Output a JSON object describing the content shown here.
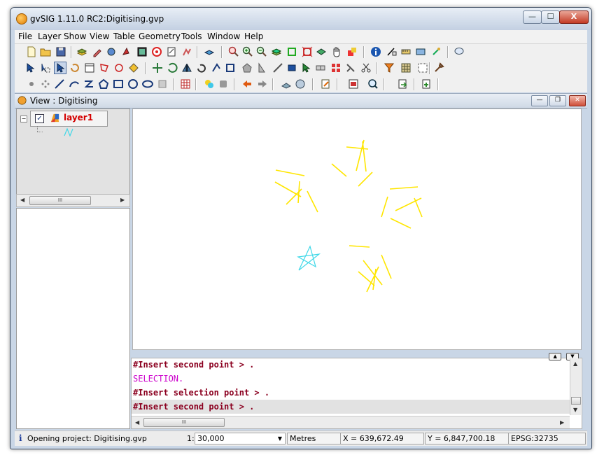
{
  "window": {
    "title": "gvSIG 1.11.0 RC2:Digitising.gvp",
    "min_label": "—",
    "max_label": "☐",
    "close_label": "X"
  },
  "menubar": {
    "items": [
      "File",
      "Layer",
      "Show",
      "View",
      "Table",
      "Geometry",
      "Tools",
      "Window",
      "Help"
    ]
  },
  "view": {
    "title": "View : Digitising"
  },
  "toc": {
    "layer_name": "layer1",
    "layer_checked": true,
    "scroll_thumb_label": "III"
  },
  "console": {
    "lines": [
      {
        "text": "#Insert second point > .",
        "color": "#8b0020",
        "bold": true
      },
      {
        "text": "SELECTION.",
        "color": "#cc00cc",
        "bold": false
      },
      {
        "text": "#Insert selection point > .",
        "color": "#8b0020",
        "bold": true
      },
      {
        "text": "#Insert second point > .",
        "color": "#8b0020",
        "bold": true
      }
    ],
    "scroll_thumb_label": "III"
  },
  "statusbar": {
    "message": "Opening project: Digitising.gvp",
    "scale_prefix": "1:",
    "scale_value": "30,000",
    "units": "Metres",
    "x_coord": "X = 639,672.49",
    "y_coord": "Y = 6,847,700.18",
    "epsg": "EPSG:32735"
  },
  "colors": {
    "selection": "#ffe600",
    "geometry": "#40d8e8",
    "layer_label": "#d40000"
  }
}
